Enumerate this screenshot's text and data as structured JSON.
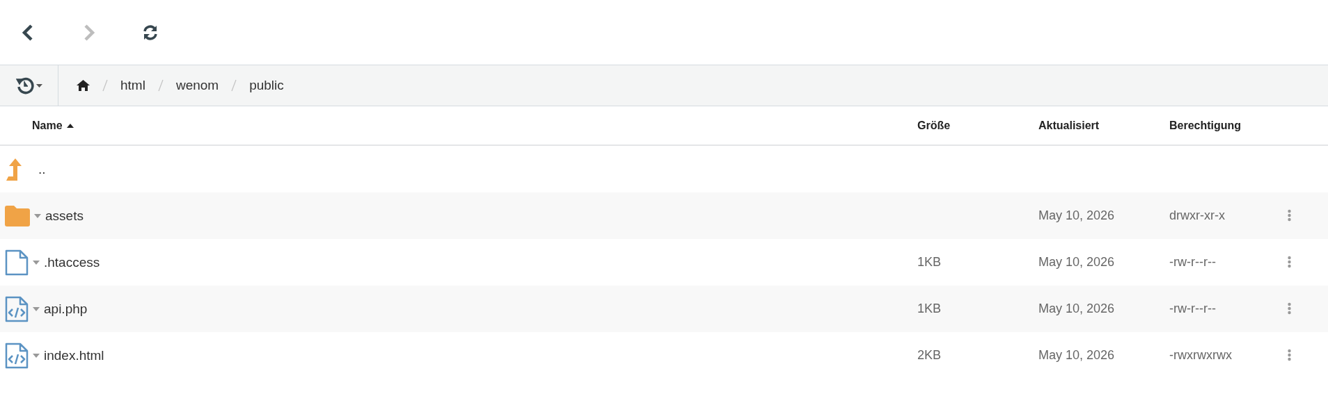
{
  "toolbar": {
    "back": {
      "disabled": false
    },
    "forward": {
      "disabled": true
    },
    "refresh": {
      "disabled": false
    }
  },
  "breadcrumb": [
    "html",
    "wenom",
    "public"
  ],
  "table": {
    "columns": [
      {
        "label": "Name",
        "sorted": true
      },
      {
        "label": "Größe",
        "sorted": false
      },
      {
        "label": "Aktualisiert",
        "sorted": false
      },
      {
        "label": "Berechtigung",
        "sorted": false
      }
    ],
    "rows": [
      {
        "kind": "parent",
        "name": ".."
      },
      {
        "kind": "folder",
        "name": "assets",
        "updated": "May 10, 2026",
        "permissions": "drwxr-xr-x"
      },
      {
        "kind": "file",
        "name": ".htaccess",
        "size": "1KB",
        "updated": "May 10, 2026",
        "permissions": "-rw-r--r--"
      },
      {
        "kind": "code",
        "name": "api.php",
        "size": "1KB",
        "updated": "May 10, 2026",
        "permissions": "-rw-r--r--"
      },
      {
        "kind": "code",
        "name": "index.html",
        "size": "2KB",
        "updated": "May 10, 2026",
        "permissions": "-rwxrwxrwx"
      }
    ]
  }
}
